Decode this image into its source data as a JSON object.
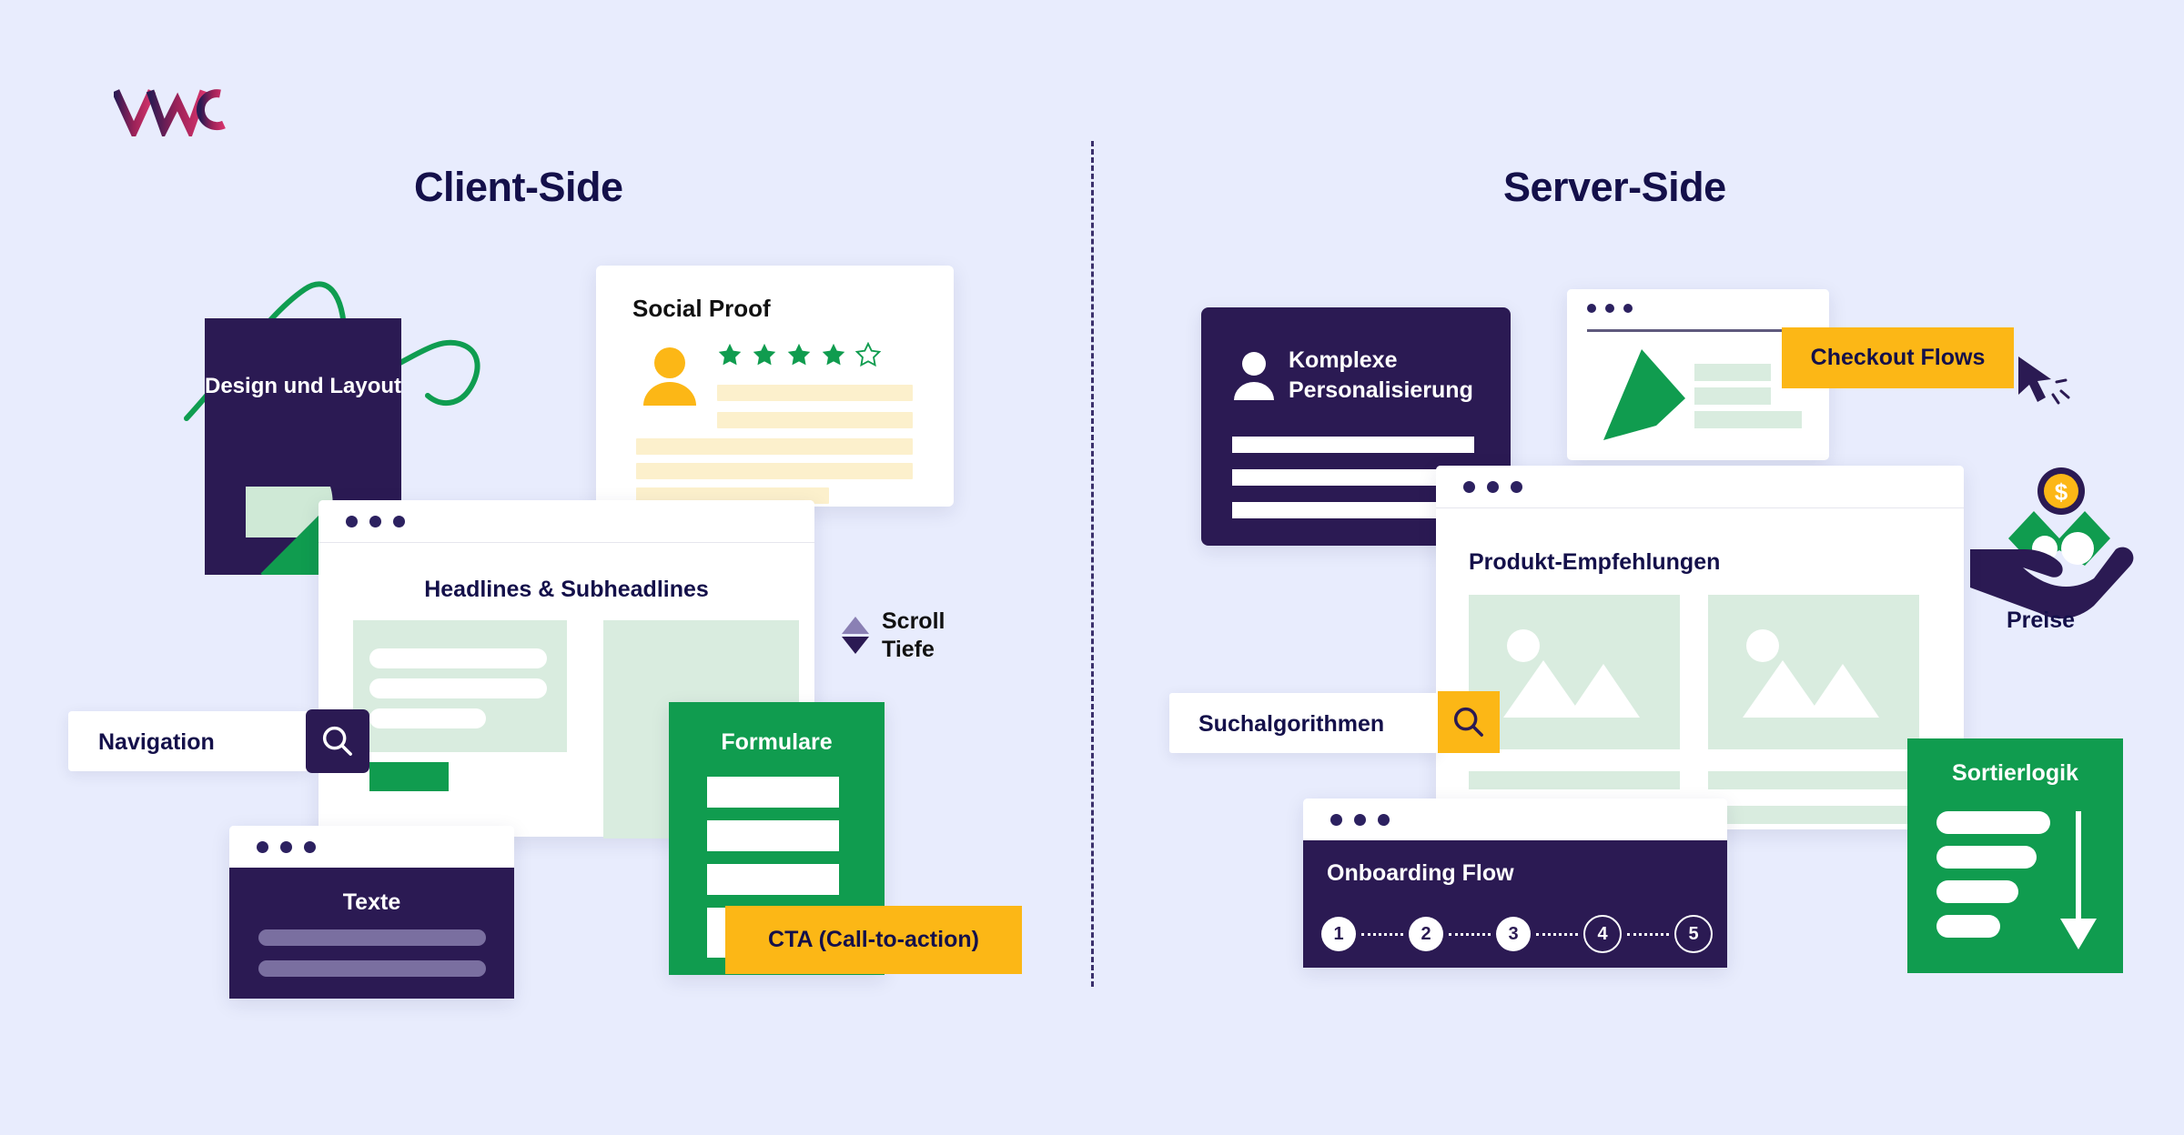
{
  "page": {
    "background_color": "#e8ecfd",
    "brand_logo": "vwo-logo"
  },
  "columns": {
    "client": {
      "title": "Client-Side"
    },
    "server": {
      "title": "Server-Side"
    }
  },
  "client_side": {
    "design_card": {
      "label": "Design und Layout",
      "color": "#2b1a53",
      "chart_icon": "pie-chart-icon"
    },
    "social_proof": {
      "title": "Social Proof",
      "avatar_icon": "user-avatar-icon",
      "stars_filled": 4,
      "stars_total": 5,
      "star_color": "#109c4f",
      "text_line_color": "#fcf0cc"
    },
    "headlines_window": {
      "title": "Headlines & Subheadlines"
    },
    "navigation": {
      "label": "Navigation",
      "search_icon": "search-icon",
      "button_color": "#2b1a53"
    },
    "scroll_depth": {
      "line1": "Scroll",
      "line2": "Tiefe",
      "up_icon": "triangle-up-icon",
      "down_icon": "triangle-down-icon"
    },
    "formulare": {
      "title": "Formulare",
      "color": "#109c4f",
      "fields": 4
    },
    "cta": {
      "label": "CTA (Call-to-action)",
      "color": "#fcb716"
    },
    "texte": {
      "title": "Texte",
      "color": "#2b1a53",
      "lines": 2
    }
  },
  "server_side": {
    "personalisierung": {
      "line1": "Komplexe",
      "line2": "Personalisierung",
      "icon": "person-icon",
      "bars": 3
    },
    "checkout": {
      "badge_label": "Checkout Flows",
      "badge_color": "#fcb716",
      "cursor_icon": "mouse-cursor-icon",
      "graphic": "green-check-icon"
    },
    "preise": {
      "label": "Preise",
      "icon": "hand-holding-money-icon",
      "coin_symbol": "$"
    },
    "produkt": {
      "title": "Produkt-Empfehlungen",
      "items": 2,
      "image_placeholder_icon": "image-placeholder-icon"
    },
    "suchalgorithmen": {
      "label": "Suchalgorithmen",
      "search_icon": "search-icon",
      "button_color": "#fcb716"
    },
    "onboarding": {
      "title": "Onboarding Flow",
      "steps": [
        {
          "number": "1",
          "state": "done"
        },
        {
          "number": "2",
          "state": "done"
        },
        {
          "number": "3",
          "state": "done"
        },
        {
          "number": "4",
          "state": "todo"
        },
        {
          "number": "5",
          "state": "todo"
        }
      ]
    },
    "sortierlogik": {
      "title": "Sortierlogik",
      "color": "#109c4f",
      "arrow_icon": "arrow-down-icon",
      "lines": 4
    }
  }
}
